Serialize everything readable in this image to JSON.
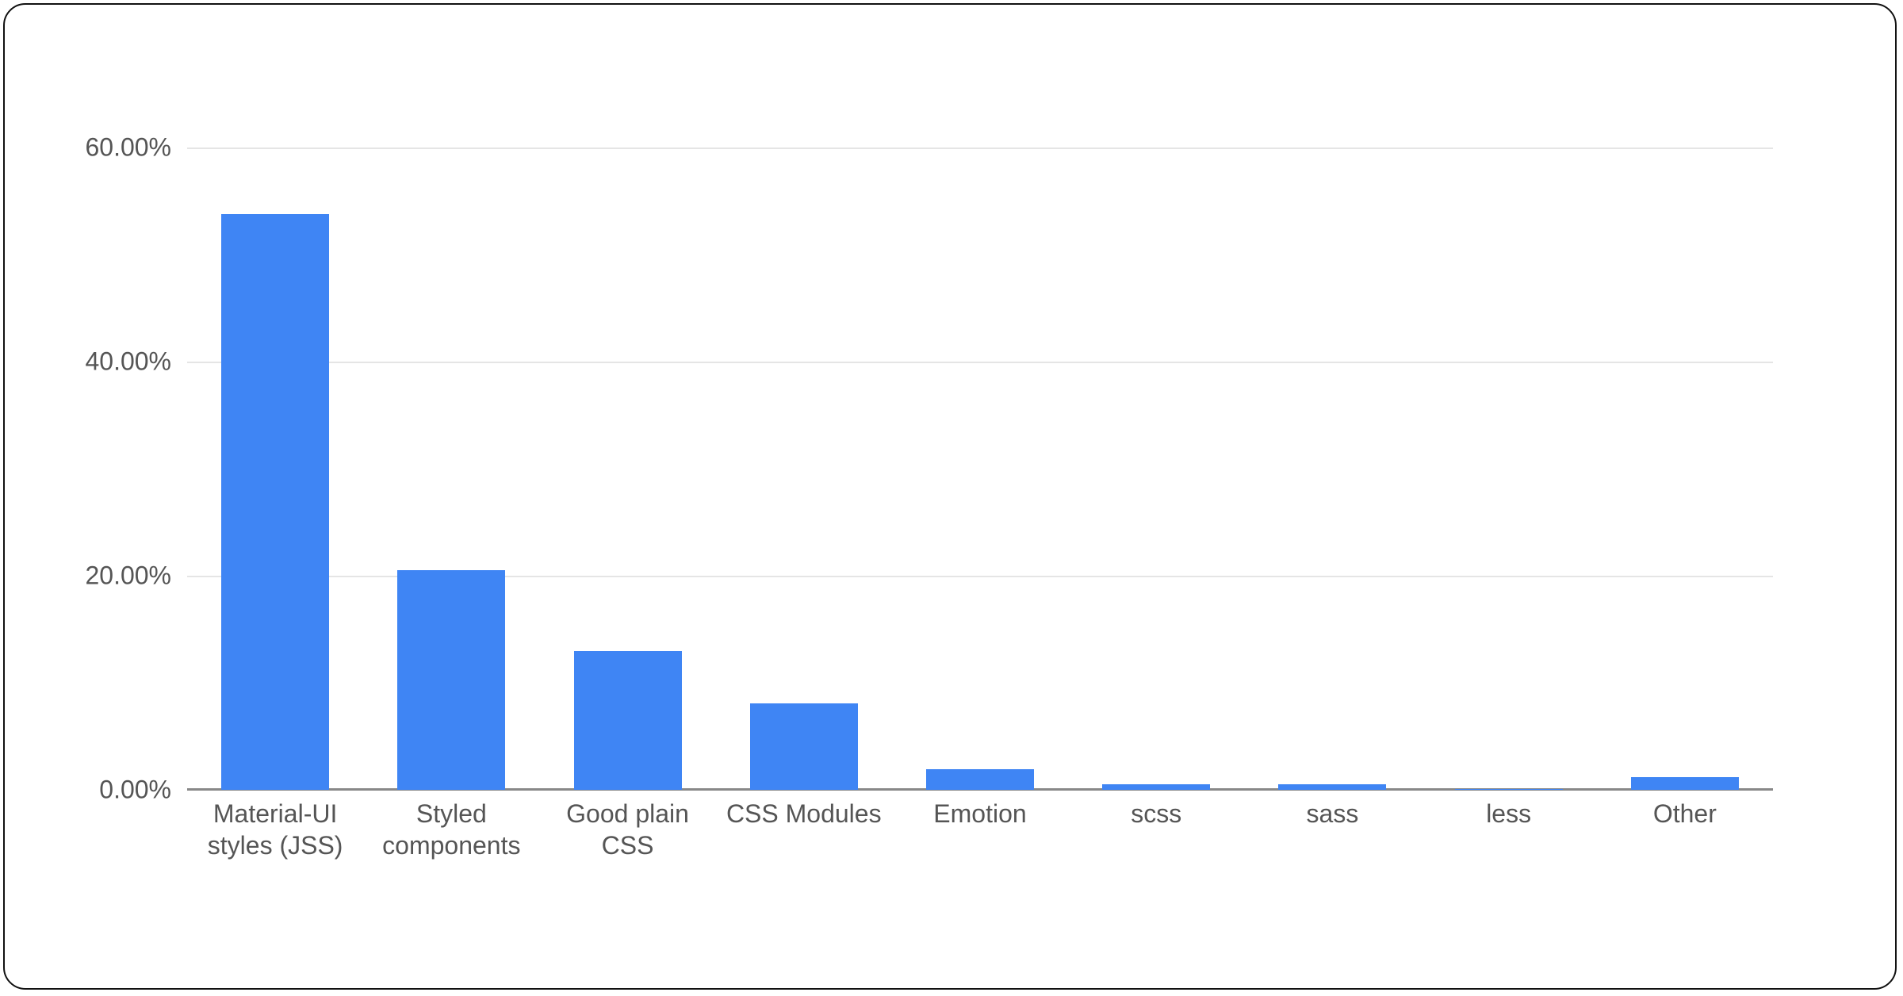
{
  "chart_data": {
    "type": "bar",
    "categories": [
      "Material-UI styles (JSS)",
      "Styled components",
      "Good plain CSS",
      "CSS Modules",
      "Emotion",
      "scss",
      "sass",
      "less",
      "Other"
    ],
    "values": [
      53.8,
      20.5,
      13.0,
      8.1,
      1.9,
      0.5,
      0.5,
      0.1,
      1.2
    ],
    "value_unit": "percent",
    "title": "",
    "xlabel": "",
    "ylabel": "",
    "ylim": [
      0,
      60
    ],
    "y_ticks": [
      0,
      20,
      40,
      60
    ],
    "y_tick_labels": [
      "0.00%",
      "20.00%",
      "40.00%",
      "60.00%"
    ],
    "bar_color": "#3f85f4"
  }
}
